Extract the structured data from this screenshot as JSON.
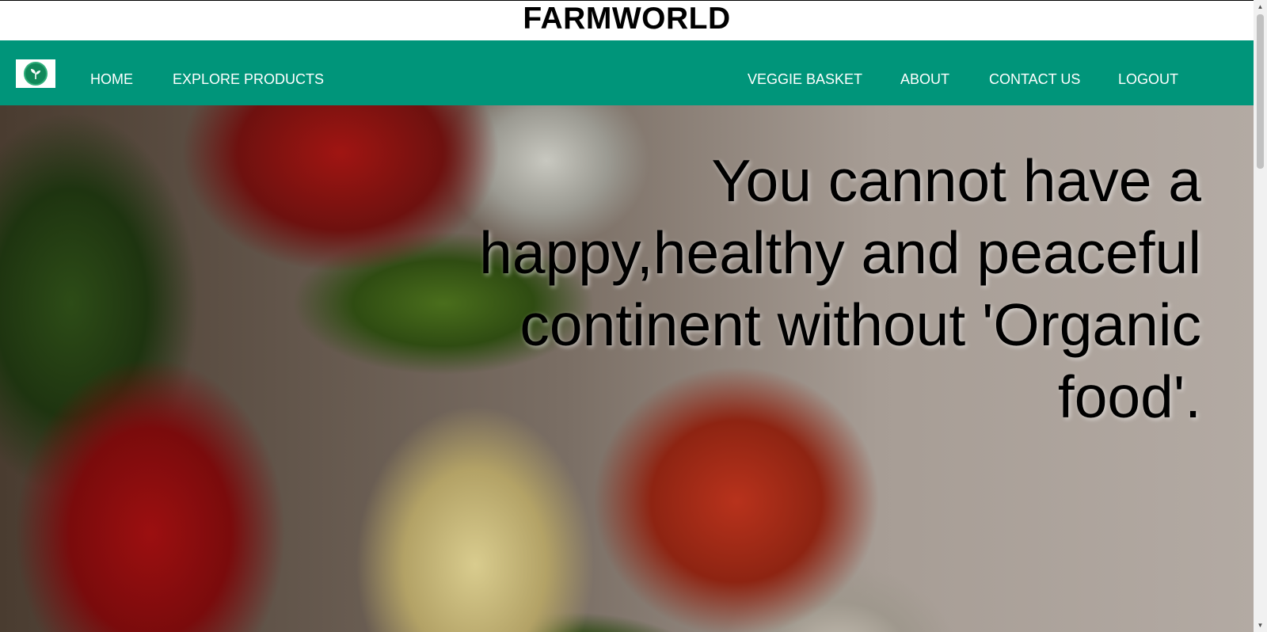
{
  "header": {
    "site_title": "FARMWORLD"
  },
  "navbar": {
    "logo_icon": "sprout-leaf-icon",
    "left_links": [
      "HOME",
      "EXPLORE PRODUCTS"
    ],
    "right_links": [
      "VEGGIE BASKET",
      "ABOUT",
      "CONTACT US",
      "LOGOUT"
    ]
  },
  "hero": {
    "quote": "You cannot have a happy,healthy and peaceful continent without 'Organic food'."
  },
  "colors": {
    "navbar": "#00957a",
    "nav_text": "#ffffff",
    "title_text": "#000000"
  }
}
